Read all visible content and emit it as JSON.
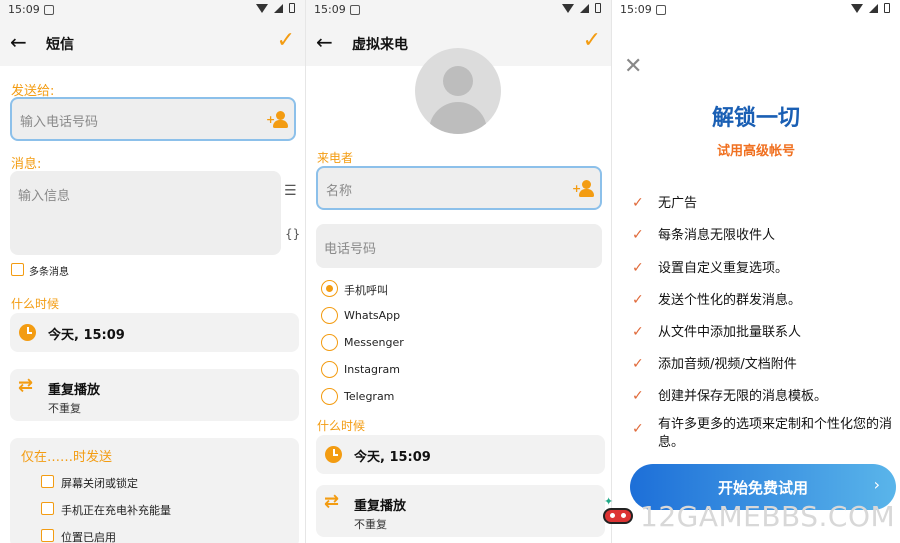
{
  "status": {
    "time": "15:09"
  },
  "sms": {
    "title": "短信",
    "send_to_label": "发送给:",
    "phone_placeholder": "输入电话号码",
    "message_label": "消息:",
    "message_placeholder": "输入信息",
    "braces_icon": "{}",
    "multi_message_label": "多条消息",
    "when_label": "什么时候",
    "when_value": "今天, 15:09",
    "repeat_title": "重复播放",
    "repeat_value": "不重复",
    "only_when_label": "仅在……时发送",
    "conditions": [
      "屏幕关闭或锁定",
      "手机正在充电补充能量",
      "位置已启用"
    ]
  },
  "fake_call": {
    "title": "虚拟来电",
    "caller_label": "来电者",
    "name_placeholder": "名称",
    "phone_placeholder": "电话号码",
    "options": [
      "手机呼叫",
      "WhatsApp",
      "Messenger",
      "Instagram",
      "Telegram"
    ],
    "selected_option": 0,
    "when_label": "什么时候",
    "when_value": "今天, 15:09",
    "repeat_title": "重复播放",
    "repeat_value": "不重复"
  },
  "premium": {
    "title": "解锁一切",
    "subtitle": "试用高级帐号",
    "features": [
      "无广告",
      "每条消息无限收件人",
      "设置自定义重复选项。",
      "发送个性化的群发消息。",
      "从文件中添加批量联系人",
      "添加音频/视频/文档附件",
      "创建并保存无限的消息模板。",
      "有许多更多的选项来定制和个性化您的消息。"
    ],
    "trial_button": "开始免费试用"
  },
  "watermark": "12GAMEBBS.COM",
  "colors": {
    "accent": "#f39c12",
    "brand_blue": "#1a5fb4",
    "subtitle_orange": "#f07020"
  }
}
